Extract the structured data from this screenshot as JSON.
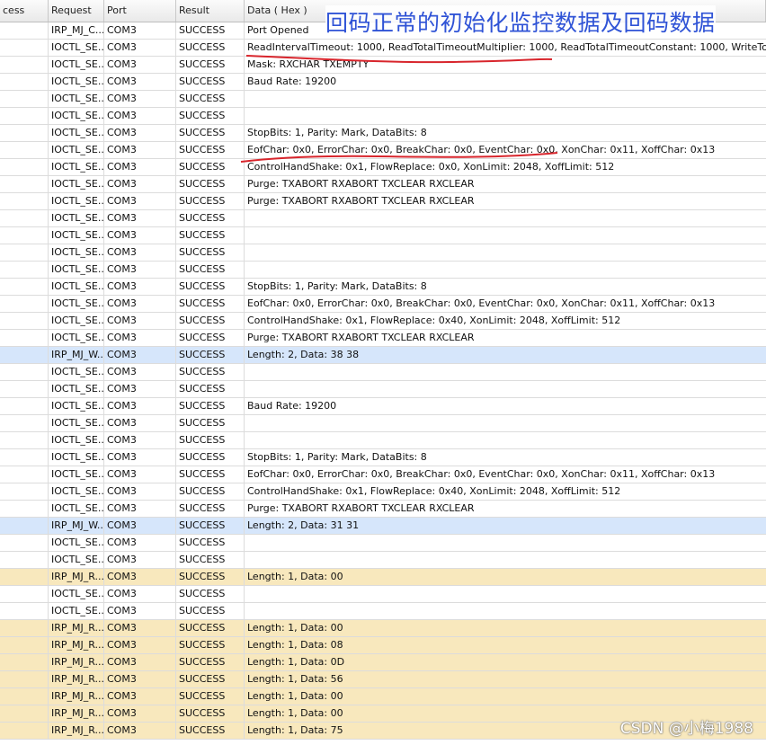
{
  "columns": [
    "cess",
    "Request",
    "Port",
    "Result",
    "Data ( Hex )"
  ],
  "annotation_caption": "回码正常的初始化监控数据及回码数据",
  "watermark": "CSDN @小梅1988",
  "rows": [
    {
      "request": "IRP_MJ_C...",
      "port": "COM3",
      "result": "SUCCESS",
      "data": "Port Opened",
      "kind": ""
    },
    {
      "request": "IOCTL_SE...",
      "port": "COM3",
      "result": "SUCCESS",
      "data": "ReadIntervalTimeout: 1000, ReadTotalTimeoutMultiplier: 1000, ReadTotalTimeoutConstant: 1000, WriteTota",
      "kind": ""
    },
    {
      "request": "IOCTL_SE...",
      "port": "COM3",
      "result": "SUCCESS",
      "data": "Mask: RXCHAR TXEMPTY",
      "kind": ""
    },
    {
      "request": "IOCTL_SE...",
      "port": "COM3",
      "result": "SUCCESS",
      "data": "Baud Rate: 19200",
      "kind": ""
    },
    {
      "request": "IOCTL_SE...",
      "port": "COM3",
      "result": "SUCCESS",
      "data": "",
      "kind": ""
    },
    {
      "request": "IOCTL_SE...",
      "port": "COM3",
      "result": "SUCCESS",
      "data": "",
      "kind": ""
    },
    {
      "request": "IOCTL_SE...",
      "port": "COM3",
      "result": "SUCCESS",
      "data": "StopBits: 1, Parity: Mark, DataBits: 8",
      "kind": ""
    },
    {
      "request": "IOCTL_SE...",
      "port": "COM3",
      "result": "SUCCESS",
      "data": "EofChar: 0x0, ErrorChar: 0x0, BreakChar: 0x0, EventChar: 0x0, XonChar: 0x11, XoffChar: 0x13",
      "kind": ""
    },
    {
      "request": "IOCTL_SE...",
      "port": "COM3",
      "result": "SUCCESS",
      "data": "ControlHandShake: 0x1, FlowReplace: 0x0, XonLimit: 2048, XoffLimit: 512",
      "kind": ""
    },
    {
      "request": "IOCTL_SE...",
      "port": "COM3",
      "result": "SUCCESS",
      "data": "Purge: TXABORT RXABORT TXCLEAR RXCLEAR",
      "kind": ""
    },
    {
      "request": "IOCTL_SE...",
      "port": "COM3",
      "result": "SUCCESS",
      "data": "Purge: TXABORT RXABORT TXCLEAR RXCLEAR",
      "kind": ""
    },
    {
      "request": "IOCTL_SE...",
      "port": "COM3",
      "result": "SUCCESS",
      "data": "",
      "kind": ""
    },
    {
      "request": "IOCTL_SE...",
      "port": "COM3",
      "result": "SUCCESS",
      "data": "",
      "kind": ""
    },
    {
      "request": "IOCTL_SE...",
      "port": "COM3",
      "result": "SUCCESS",
      "data": "",
      "kind": ""
    },
    {
      "request": "IOCTL_SE...",
      "port": "COM3",
      "result": "SUCCESS",
      "data": "",
      "kind": ""
    },
    {
      "request": "IOCTL_SE...",
      "port": "COM3",
      "result": "SUCCESS",
      "data": "StopBits: 1, Parity: Mark, DataBits: 8",
      "kind": ""
    },
    {
      "request": "IOCTL_SE...",
      "port": "COM3",
      "result": "SUCCESS",
      "data": "EofChar: 0x0, ErrorChar: 0x0, BreakChar: 0x0, EventChar: 0x0, XonChar: 0x11, XoffChar: 0x13",
      "kind": ""
    },
    {
      "request": "IOCTL_SE...",
      "port": "COM3",
      "result": "SUCCESS",
      "data": "ControlHandShake: 0x1, FlowReplace: 0x40, XonLimit: 2048, XoffLimit: 512",
      "kind": ""
    },
    {
      "request": "IOCTL_SE...",
      "port": "COM3",
      "result": "SUCCESS",
      "data": "Purge: TXABORT RXABORT TXCLEAR RXCLEAR",
      "kind": ""
    },
    {
      "request": "IRP_MJ_W...",
      "port": "COM3",
      "result": "SUCCESS",
      "data": "Length: 2, Data: 38 38",
      "kind": "write"
    },
    {
      "request": "IOCTL_SE...",
      "port": "COM3",
      "result": "SUCCESS",
      "data": "",
      "kind": ""
    },
    {
      "request": "IOCTL_SE...",
      "port": "COM3",
      "result": "SUCCESS",
      "data": "",
      "kind": ""
    },
    {
      "request": "IOCTL_SE...",
      "port": "COM3",
      "result": "SUCCESS",
      "data": "Baud Rate: 19200",
      "kind": ""
    },
    {
      "request": "IOCTL_SE...",
      "port": "COM3",
      "result": "SUCCESS",
      "data": "",
      "kind": ""
    },
    {
      "request": "IOCTL_SE...",
      "port": "COM3",
      "result": "SUCCESS",
      "data": "",
      "kind": ""
    },
    {
      "request": "IOCTL_SE...",
      "port": "COM3",
      "result": "SUCCESS",
      "data": "StopBits: 1, Parity: Mark, DataBits: 8",
      "kind": ""
    },
    {
      "request": "IOCTL_SE...",
      "port": "COM3",
      "result": "SUCCESS",
      "data": "EofChar: 0x0, ErrorChar: 0x0, BreakChar: 0x0, EventChar: 0x0, XonChar: 0x11, XoffChar: 0x13",
      "kind": ""
    },
    {
      "request": "IOCTL_SE...",
      "port": "COM3",
      "result": "SUCCESS",
      "data": "ControlHandShake: 0x1, FlowReplace: 0x40, XonLimit: 2048, XoffLimit: 512",
      "kind": ""
    },
    {
      "request": "IOCTL_SE...",
      "port": "COM3",
      "result": "SUCCESS",
      "data": "Purge: TXABORT RXABORT TXCLEAR RXCLEAR",
      "kind": ""
    },
    {
      "request": "IRP_MJ_W...",
      "port": "COM3",
      "result": "SUCCESS",
      "data": "Length: 2, Data: 31 31",
      "kind": "write"
    },
    {
      "request": "IOCTL_SE...",
      "port": "COM3",
      "result": "SUCCESS",
      "data": "",
      "kind": ""
    },
    {
      "request": "IOCTL_SE...",
      "port": "COM3",
      "result": "SUCCESS",
      "data": "",
      "kind": ""
    },
    {
      "request": "IRP_MJ_R...",
      "port": "COM3",
      "result": "SUCCESS",
      "data": "Length: 1, Data: 00",
      "kind": "read"
    },
    {
      "request": "IOCTL_SE...",
      "port": "COM3",
      "result": "SUCCESS",
      "data": "",
      "kind": ""
    },
    {
      "request": "IOCTL_SE...",
      "port": "COM3",
      "result": "SUCCESS",
      "data": "",
      "kind": ""
    },
    {
      "request": "IRP_MJ_R...",
      "port": "COM3",
      "result": "SUCCESS",
      "data": "Length: 1, Data: 00",
      "kind": "read"
    },
    {
      "request": "IRP_MJ_R...",
      "port": "COM3",
      "result": "SUCCESS",
      "data": "Length: 1, Data: 08",
      "kind": "read"
    },
    {
      "request": "IRP_MJ_R...",
      "port": "COM3",
      "result": "SUCCESS",
      "data": "Length: 1, Data: 0D",
      "kind": "read"
    },
    {
      "request": "IRP_MJ_R...",
      "port": "COM3",
      "result": "SUCCESS",
      "data": "Length: 1, Data: 56",
      "kind": "read"
    },
    {
      "request": "IRP_MJ_R...",
      "port": "COM3",
      "result": "SUCCESS",
      "data": "Length: 1, Data: 00",
      "kind": "read"
    },
    {
      "request": "IRP_MJ_R...",
      "port": "COM3",
      "result": "SUCCESS",
      "data": "Length: 1, Data: 00",
      "kind": "read"
    },
    {
      "request": "IRP_MJ_R...",
      "port": "COM3",
      "result": "SUCCESS",
      "data": "Length: 1, Data: 75",
      "kind": "read"
    }
  ],
  "colors": {
    "write_row": "#d6e6fb",
    "read_row": "#f8e8bd",
    "annotation": "#2f53d6",
    "underline": "#d8252c"
  }
}
